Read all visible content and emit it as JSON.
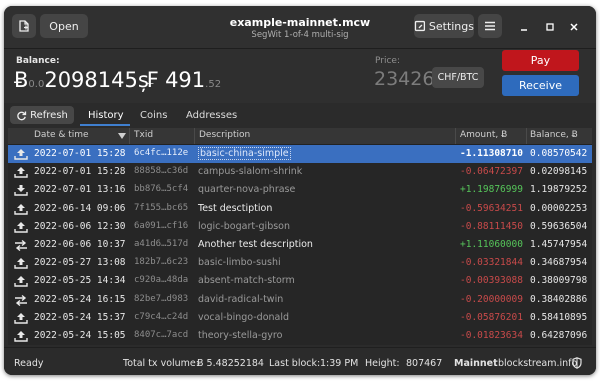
{
  "header": {
    "open_label": "Open",
    "title": "example-mainnet.mcw",
    "subtitle": "SegWit 1-of-4 multi-sig",
    "settings_label": "Settings"
  },
  "balance": {
    "label": "Balance:",
    "btc_symbol": "Ƀ",
    "btc_dim": "0.0",
    "btc_value": "2098145",
    "btc_unit": "ș",
    "fiat_symbol": "₣",
    "fiat_value": "491",
    "fiat_decimals": ".52"
  },
  "price": {
    "label": "Price:",
    "value": "23426",
    "currency": "CHF/BTC"
  },
  "actions": {
    "pay": "Pay",
    "receive": "Receive"
  },
  "tabs": {
    "refresh": "Refresh",
    "items": [
      "History",
      "Coins",
      "Addresses"
    ],
    "active": "History"
  },
  "table": {
    "columns": [
      "Date & time",
      "Txid",
      "Description",
      "Amount, Ƀ",
      "Balance, Ƀ"
    ],
    "rows": [
      {
        "dir": "out",
        "date": "2022-07-01 15:28",
        "txid": "6c4fc…112e",
        "desc": "basic-china-simple",
        "amount": "-1.11308710",
        "balance": "0.08570542",
        "sign": "neg",
        "strong": false,
        "selected": true
      },
      {
        "dir": "out",
        "date": "2022-07-01 15:28",
        "txid": "88858…c36d",
        "desc": "campus-slalom-shrink",
        "amount": "-0.06472397",
        "balance": "0.02098145",
        "sign": "neg",
        "strong": false,
        "selected": false
      },
      {
        "dir": "in",
        "date": "2022-07-01 13:16",
        "txid": "bb876…5cf4",
        "desc": "quarter-nova-phrase",
        "amount": "+1.19876999",
        "balance": "1.19879252",
        "sign": "pos",
        "strong": false,
        "selected": false
      },
      {
        "dir": "out",
        "date": "2022-06-14 09:06",
        "txid": "7f155…bc65",
        "desc": "Test desctiption",
        "amount": "-0.59634251",
        "balance": "0.00002253",
        "sign": "neg",
        "strong": true,
        "selected": false
      },
      {
        "dir": "out",
        "date": "2022-06-06 12:30",
        "txid": "6a091…cf16",
        "desc": "logic-bogart-gibson",
        "amount": "-0.88111450",
        "balance": "0.59636504",
        "sign": "neg",
        "strong": false,
        "selected": false
      },
      {
        "dir": "swap",
        "date": "2022-06-06 10:37",
        "txid": "a41d6…517d",
        "desc": "Another test description",
        "amount": "+1.11060000",
        "balance": "1.45747954",
        "sign": "pos",
        "strong": true,
        "selected": false
      },
      {
        "dir": "out",
        "date": "2022-05-27 13:08",
        "txid": "182b7…6c23",
        "desc": "basic-limbo-sushi",
        "amount": "-0.03321844",
        "balance": "0.34687954",
        "sign": "neg",
        "strong": false,
        "selected": false
      },
      {
        "dir": "out",
        "date": "2022-05-25 14:34",
        "txid": "c920a…48da",
        "desc": "absent-match-storm",
        "amount": "-0.00393088",
        "balance": "0.38009798",
        "sign": "neg",
        "strong": false,
        "selected": false
      },
      {
        "dir": "swap",
        "date": "2022-05-24 16:15",
        "txid": "82be7…d983",
        "desc": "david-radical-twin",
        "amount": "-0.20000009",
        "balance": "0.38402886",
        "sign": "neg",
        "strong": false,
        "selected": false
      },
      {
        "dir": "out",
        "date": "2022-05-24 15:37",
        "txid": "c79c4…c24d",
        "desc": "vocal-bingo-donald",
        "amount": "-0.05876201",
        "balance": "0.58410895",
        "sign": "neg",
        "strong": false,
        "selected": false
      },
      {
        "dir": "out",
        "date": "2022-05-24 15:05",
        "txid": "8407c…7acd",
        "desc": "theory-stella-gyro",
        "amount": "-0.01823634",
        "balance": "0.64287096",
        "sign": "neg",
        "strong": false,
        "selected": false
      }
    ]
  },
  "status": {
    "ready": "Ready",
    "volume_label": "Total tx volume:",
    "volume_value": "Ƀ 5.48252184",
    "lastblock_label": "Last block:",
    "lastblock_value": "1:39 PM",
    "height_label": "Height:",
    "height_value": "807467",
    "network": "Mainnet",
    "explorer": "blockstream.info"
  },
  "colors": {
    "accent": "#2e6bbd",
    "pay": "#c0161c",
    "selected_row": "#3a6fc0",
    "negative": "#c84a4a",
    "positive": "#56c55a"
  }
}
